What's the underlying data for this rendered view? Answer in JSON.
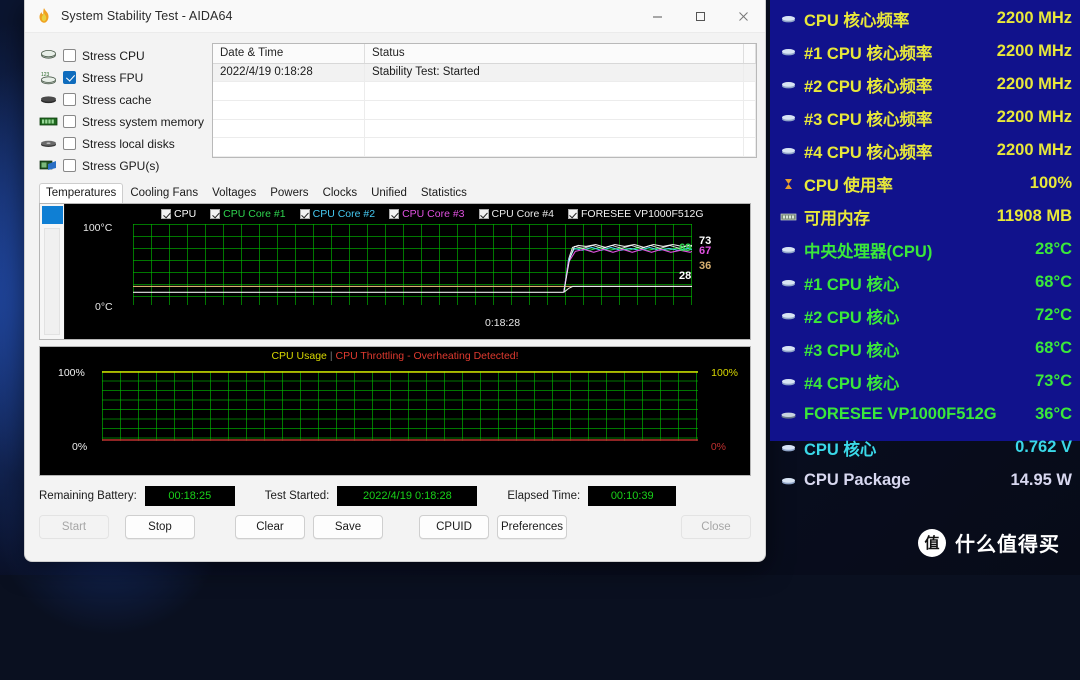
{
  "window": {
    "title": "System Stability Test - AIDA64",
    "icon": "flame-icon",
    "controls": {
      "minimize": "minimize-icon",
      "maximize": "maximize-icon",
      "close": "close-icon"
    }
  },
  "stress_options": [
    {
      "label": "Stress CPU",
      "checked": false,
      "icon": "cpu-chip-icon"
    },
    {
      "label": "Stress FPU",
      "checked": true,
      "icon": "fpu-chip-icon"
    },
    {
      "label": "Stress cache",
      "checked": false,
      "icon": "cache-icon"
    },
    {
      "label": "Stress system memory",
      "checked": false,
      "icon": "memory-module-icon"
    },
    {
      "label": "Stress local disks",
      "checked": false,
      "icon": "hard-disk-icon"
    },
    {
      "label": "Stress GPU(s)",
      "checked": false,
      "icon": "gpu-card-icon"
    }
  ],
  "log": {
    "columns": [
      "Date & Time",
      "Status"
    ],
    "rows": [
      {
        "datetime": "2022/4/19 0:18:28",
        "status": "Stability Test: Started"
      }
    ]
  },
  "tabs": [
    {
      "label": "Temperatures",
      "active": true
    },
    {
      "label": "Cooling Fans",
      "active": false
    },
    {
      "label": "Voltages",
      "active": false
    },
    {
      "label": "Powers",
      "active": false
    },
    {
      "label": "Clocks",
      "active": false
    },
    {
      "label": "Unified",
      "active": false
    },
    {
      "label": "Statistics",
      "active": false
    }
  ],
  "chart_data": [
    {
      "type": "line",
      "title": "Temperatures",
      "ylabel": "",
      "xlabel": "",
      "ylim": [
        0,
        100
      ],
      "y_top_label": "100°C",
      "y_bottom_label": "0°C",
      "x_tick_labels": [
        "0:18:28"
      ],
      "grid": true,
      "legend_position": "top",
      "series": [
        {
          "name": "CPU",
          "color": "#ffffff",
          "checked": true,
          "current": 73,
          "unit": "°C"
        },
        {
          "name": "CPU Core #1",
          "color": "#2fd44f",
          "checked": true,
          "current": 69,
          "unit": "°C"
        },
        {
          "name": "CPU Core #2",
          "color": "#45c8f0",
          "checked": true,
          "current": 69,
          "unit": "°C"
        },
        {
          "name": "CPU Core #3",
          "color": "#e050e0",
          "checked": true,
          "current": 67,
          "unit": "°C"
        },
        {
          "name": "CPU Core #4",
          "color": "#e8e8e8",
          "checked": true,
          "current": 73,
          "unit": "°C"
        },
        {
          "name": "FORESEE VP1000F512G",
          "color": "#f0f0f0",
          "checked": true,
          "current": 36,
          "unit": "°C"
        }
      ],
      "edge_values": [
        {
          "text": "69",
          "color": "#2fd44f"
        },
        {
          "text": "73",
          "color": "#ffffff"
        },
        {
          "text": "67",
          "color": "#e050e0"
        },
        {
          "text": "28",
          "color": "#ffffff"
        },
        {
          "text": "36",
          "color": "#d8b070"
        }
      ]
    },
    {
      "type": "line",
      "title": "CPU Usage",
      "warning": "CPU Throttling - Overheating Detected!",
      "ylim": [
        0,
        100
      ],
      "y_top_label": "100%",
      "y_bottom_label": "0%",
      "y_top_label_right": "100%",
      "y_bottom_label_right": "0%",
      "grid": true,
      "series": [
        {
          "name": "CPU Usage",
          "color": "#d9d900",
          "current": 100,
          "unit": "%"
        },
        {
          "name": "CPU Throttling",
          "color": "#c03030",
          "current": 0,
          "unit": "%"
        }
      ]
    }
  ],
  "status": {
    "battery_label": "Remaining Battery:",
    "battery_value": "00:18:25",
    "started_label": "Test Started:",
    "started_value": "2022/4/19 0:18:28",
    "elapsed_label": "Elapsed Time:",
    "elapsed_value": "00:10:39"
  },
  "buttons": [
    {
      "label": "Start",
      "disabled": true
    },
    {
      "label": "Stop",
      "disabled": false
    },
    {
      "label": "Clear",
      "disabled": false
    },
    {
      "label": "Save",
      "disabled": false
    },
    {
      "label": "CPUID",
      "disabled": false
    },
    {
      "label": "Preferences",
      "disabled": false
    },
    {
      "label": "Close",
      "disabled": true
    }
  ],
  "osd": {
    "background": "#11128c",
    "rows": [
      {
        "name": "CPU 核心频率",
        "value": "2200 MHz",
        "color": "#e8e83a",
        "icon": "cpu-icon"
      },
      {
        "name": "#1 CPU 核心频率",
        "value": "2200 MHz",
        "color": "#e8e83a",
        "icon": "cpu-icon"
      },
      {
        "name": "#2 CPU 核心频率",
        "value": "2200 MHz",
        "color": "#e8e83a",
        "icon": "cpu-icon"
      },
      {
        "name": "#3 CPU 核心频率",
        "value": "2200 MHz",
        "color": "#e8e83a",
        "icon": "cpu-icon"
      },
      {
        "name": "#4 CPU 核心频率",
        "value": "2200 MHz",
        "color": "#e8e83a",
        "icon": "cpu-icon"
      },
      {
        "name": "CPU 使用率",
        "value": "100%",
        "color": "#e8e83a",
        "icon": "usage-icon"
      },
      {
        "name": "可用内存",
        "value": "11908 MB",
        "color": "#e8e83a",
        "icon": "memory-icon"
      },
      {
        "name": "中央处理器(CPU)",
        "value": "28°C",
        "color": "#3ae83a",
        "icon": "cpu-icon"
      },
      {
        "name": "#1 CPU 核心",
        "value": "68°C",
        "color": "#3ae83a",
        "icon": "cpu-icon"
      },
      {
        "name": "#2 CPU 核心",
        "value": "72°C",
        "color": "#3ae83a",
        "icon": "cpu-icon"
      },
      {
        "name": "#3 CPU 核心",
        "value": "68°C",
        "color": "#3ae83a",
        "icon": "cpu-icon"
      },
      {
        "name": "#4 CPU 核心",
        "value": "73°C",
        "color": "#3ae83a",
        "icon": "cpu-icon"
      },
      {
        "name": "FORESEE VP1000F512G",
        "value": "36°C",
        "color": "#3ae83a",
        "icon": "disk-icon"
      },
      {
        "name": "CPU 核心",
        "value": "0.762 V",
        "color": "#3ad8e8",
        "icon": "voltage-icon"
      },
      {
        "name": "CPU Package",
        "value": "14.95 W",
        "color": "#d8d8f0",
        "icon": "power-icon"
      }
    ]
  },
  "watermark": {
    "badge": "值",
    "text": "什么值得买"
  }
}
